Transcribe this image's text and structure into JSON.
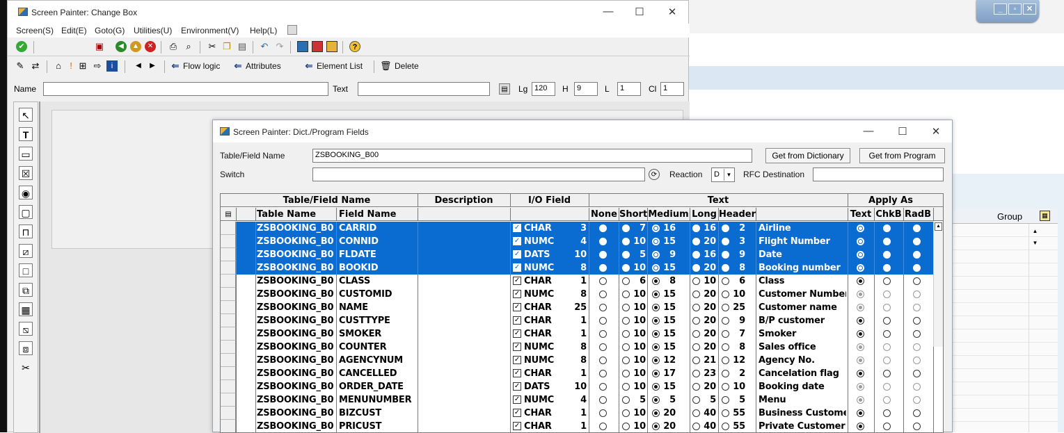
{
  "main_window": {
    "title": "Screen Painter:  Change Box",
    "menu": [
      "Screen(S)",
      "Edit(E)",
      "Goto(G)",
      "Utilities(U)",
      "Environment(V)",
      "Help(L)"
    ],
    "toolbar2": {
      "flow_logic": "Flow logic",
      "attributes": "Attributes",
      "element_list": "Element List",
      "delete": "Delete"
    },
    "name_label": "Name",
    "text_label": "Text",
    "lg_label": "Lg",
    "lg_value": "120",
    "h_label": "H",
    "h_value": "9",
    "l_label": "L",
    "l_value": "1",
    "cl_label": "Cl",
    "cl_value": "1"
  },
  "background": {
    "group_header": "Group"
  },
  "dialog": {
    "title": "Screen Painter: Dict./Program Fields",
    "table_field_label": "Table/Field Name",
    "table_field_value": "ZSBOOKING_B00",
    "switch_label": "Switch",
    "reaction_label": "Reaction",
    "reaction_value": "D",
    "rfc_label": "RFC Destination",
    "btn_dictionary": "Get from Dictionary",
    "btn_program": "Get from Program"
  },
  "table": {
    "group_headers": {
      "tablefield": "Table/Field Name",
      "description": "Description",
      "io": "I/O Field",
      "text": "Text",
      "apply": "Apply As"
    },
    "col_headers": {
      "table": "Table Name",
      "field": "Field Name",
      "none": "None",
      "short": "Short",
      "medium": "Medium",
      "long": "Long",
      "header": "Header",
      "ap_text": "Text",
      "ap_chkb": "ChkB",
      "ap_radb": "RadB"
    },
    "rows": [
      {
        "table": "ZSBOOKING_B0",
        "field": "CARRID",
        "type": "CHAR",
        "len": "3",
        "short": "7",
        "medium": "16",
        "long": "16",
        "header": "2",
        "text": "Airline",
        "sel": true,
        "ms": "medium",
        "ap": "text",
        "dis": false
      },
      {
        "table": "ZSBOOKING_B0",
        "field": "CONNID",
        "type": "NUMC",
        "len": "4",
        "short": "10",
        "medium": "15",
        "long": "20",
        "header": "3",
        "text": "Flight Number",
        "sel": true,
        "ms": "medium",
        "ap": "text",
        "dis": false
      },
      {
        "table": "ZSBOOKING_B0",
        "field": "FLDATE",
        "type": "DATS",
        "len": "10",
        "short": "5",
        "medium": "9",
        "long": "16",
        "header": "9",
        "text": "Date",
        "sel": true,
        "ms": "medium",
        "ap": "text",
        "dis": false
      },
      {
        "table": "ZSBOOKING_B0",
        "field": "BOOKID",
        "type": "NUMC",
        "len": "8",
        "short": "10",
        "medium": "15",
        "long": "20",
        "header": "8",
        "text": "Booking number",
        "sel": true,
        "ms": "medium",
        "ap": "text",
        "dis": false
      },
      {
        "table": "ZSBOOKING_B0",
        "field": "CLASS",
        "type": "CHAR",
        "len": "1",
        "short": "6",
        "medium": "8",
        "long": "10",
        "header": "6",
        "text": "Class",
        "sel": false,
        "ms": "medium",
        "ap": "text",
        "dis": false
      },
      {
        "table": "ZSBOOKING_B0",
        "field": "CUSTOMID",
        "type": "NUMC",
        "len": "8",
        "short": "10",
        "medium": "15",
        "long": "20",
        "header": "10",
        "text": "Customer Number",
        "sel": false,
        "ms": "medium",
        "ap": "text",
        "dis": true
      },
      {
        "table": "ZSBOOKING_B0",
        "field": "NAME",
        "type": "CHAR",
        "len": "25",
        "short": "10",
        "medium": "15",
        "long": "20",
        "header": "25",
        "text": "Customer name",
        "sel": false,
        "ms": "medium",
        "ap": "text",
        "dis": true
      },
      {
        "table": "ZSBOOKING_B0",
        "field": "CUSTTYPE",
        "type": "CHAR",
        "len": "1",
        "short": "10",
        "medium": "15",
        "long": "20",
        "header": "9",
        "text": "B/P customer",
        "sel": false,
        "ms": "medium",
        "ap": "text",
        "dis": false
      },
      {
        "table": "ZSBOOKING_B0",
        "field": "SMOKER",
        "type": "CHAR",
        "len": "1",
        "short": "10",
        "medium": "15",
        "long": "20",
        "header": "7",
        "text": "Smoker",
        "sel": false,
        "ms": "medium",
        "ap": "text",
        "dis": false
      },
      {
        "table": "ZSBOOKING_B0",
        "field": "COUNTER",
        "type": "NUMC",
        "len": "8",
        "short": "10",
        "medium": "15",
        "long": "20",
        "header": "8",
        "text": "Sales office",
        "sel": false,
        "ms": "medium",
        "ap": "text",
        "dis": true
      },
      {
        "table": "ZSBOOKING_B0",
        "field": "AGENCYNUM",
        "type": "NUMC",
        "len": "8",
        "short": "10",
        "medium": "12",
        "long": "21",
        "header": "12",
        "text": "Agency No.",
        "sel": false,
        "ms": "medium",
        "ap": "text",
        "dis": true
      },
      {
        "table": "ZSBOOKING_B0",
        "field": "CANCELLED",
        "type": "CHAR",
        "len": "1",
        "short": "10",
        "medium": "17",
        "long": "23",
        "header": "2",
        "text": "Cancelation flag",
        "sel": false,
        "ms": "medium",
        "ap": "text",
        "dis": false
      },
      {
        "table": "ZSBOOKING_B0",
        "field": "ORDER_DATE",
        "type": "DATS",
        "len": "10",
        "short": "10",
        "medium": "15",
        "long": "20",
        "header": "10",
        "text": "Booking date",
        "sel": false,
        "ms": "medium",
        "ap": "text",
        "dis": true
      },
      {
        "table": "ZSBOOKING_B0",
        "field": "MENUNUMBER",
        "type": "NUMC",
        "len": "4",
        "short": "5",
        "medium": "5",
        "long": "5",
        "header": "5",
        "text": "Menu",
        "sel": false,
        "ms": "medium",
        "ap": "text",
        "dis": true
      },
      {
        "table": "ZSBOOKING_B0",
        "field": "BIZCUST",
        "type": "CHAR",
        "len": "1",
        "short": "10",
        "medium": "20",
        "long": "40",
        "header": "55",
        "text": "Business Custome",
        "sel": false,
        "ms": "medium",
        "ap": "text",
        "dis": false
      },
      {
        "table": "ZSBOOKING_B0",
        "field": "PRICUST",
        "type": "CHAR",
        "len": "1",
        "short": "10",
        "medium": "20",
        "long": "40",
        "header": "55",
        "text": "Private Customer",
        "sel": false,
        "ms": "medium",
        "ap": "text",
        "dis": false
      }
    ]
  }
}
